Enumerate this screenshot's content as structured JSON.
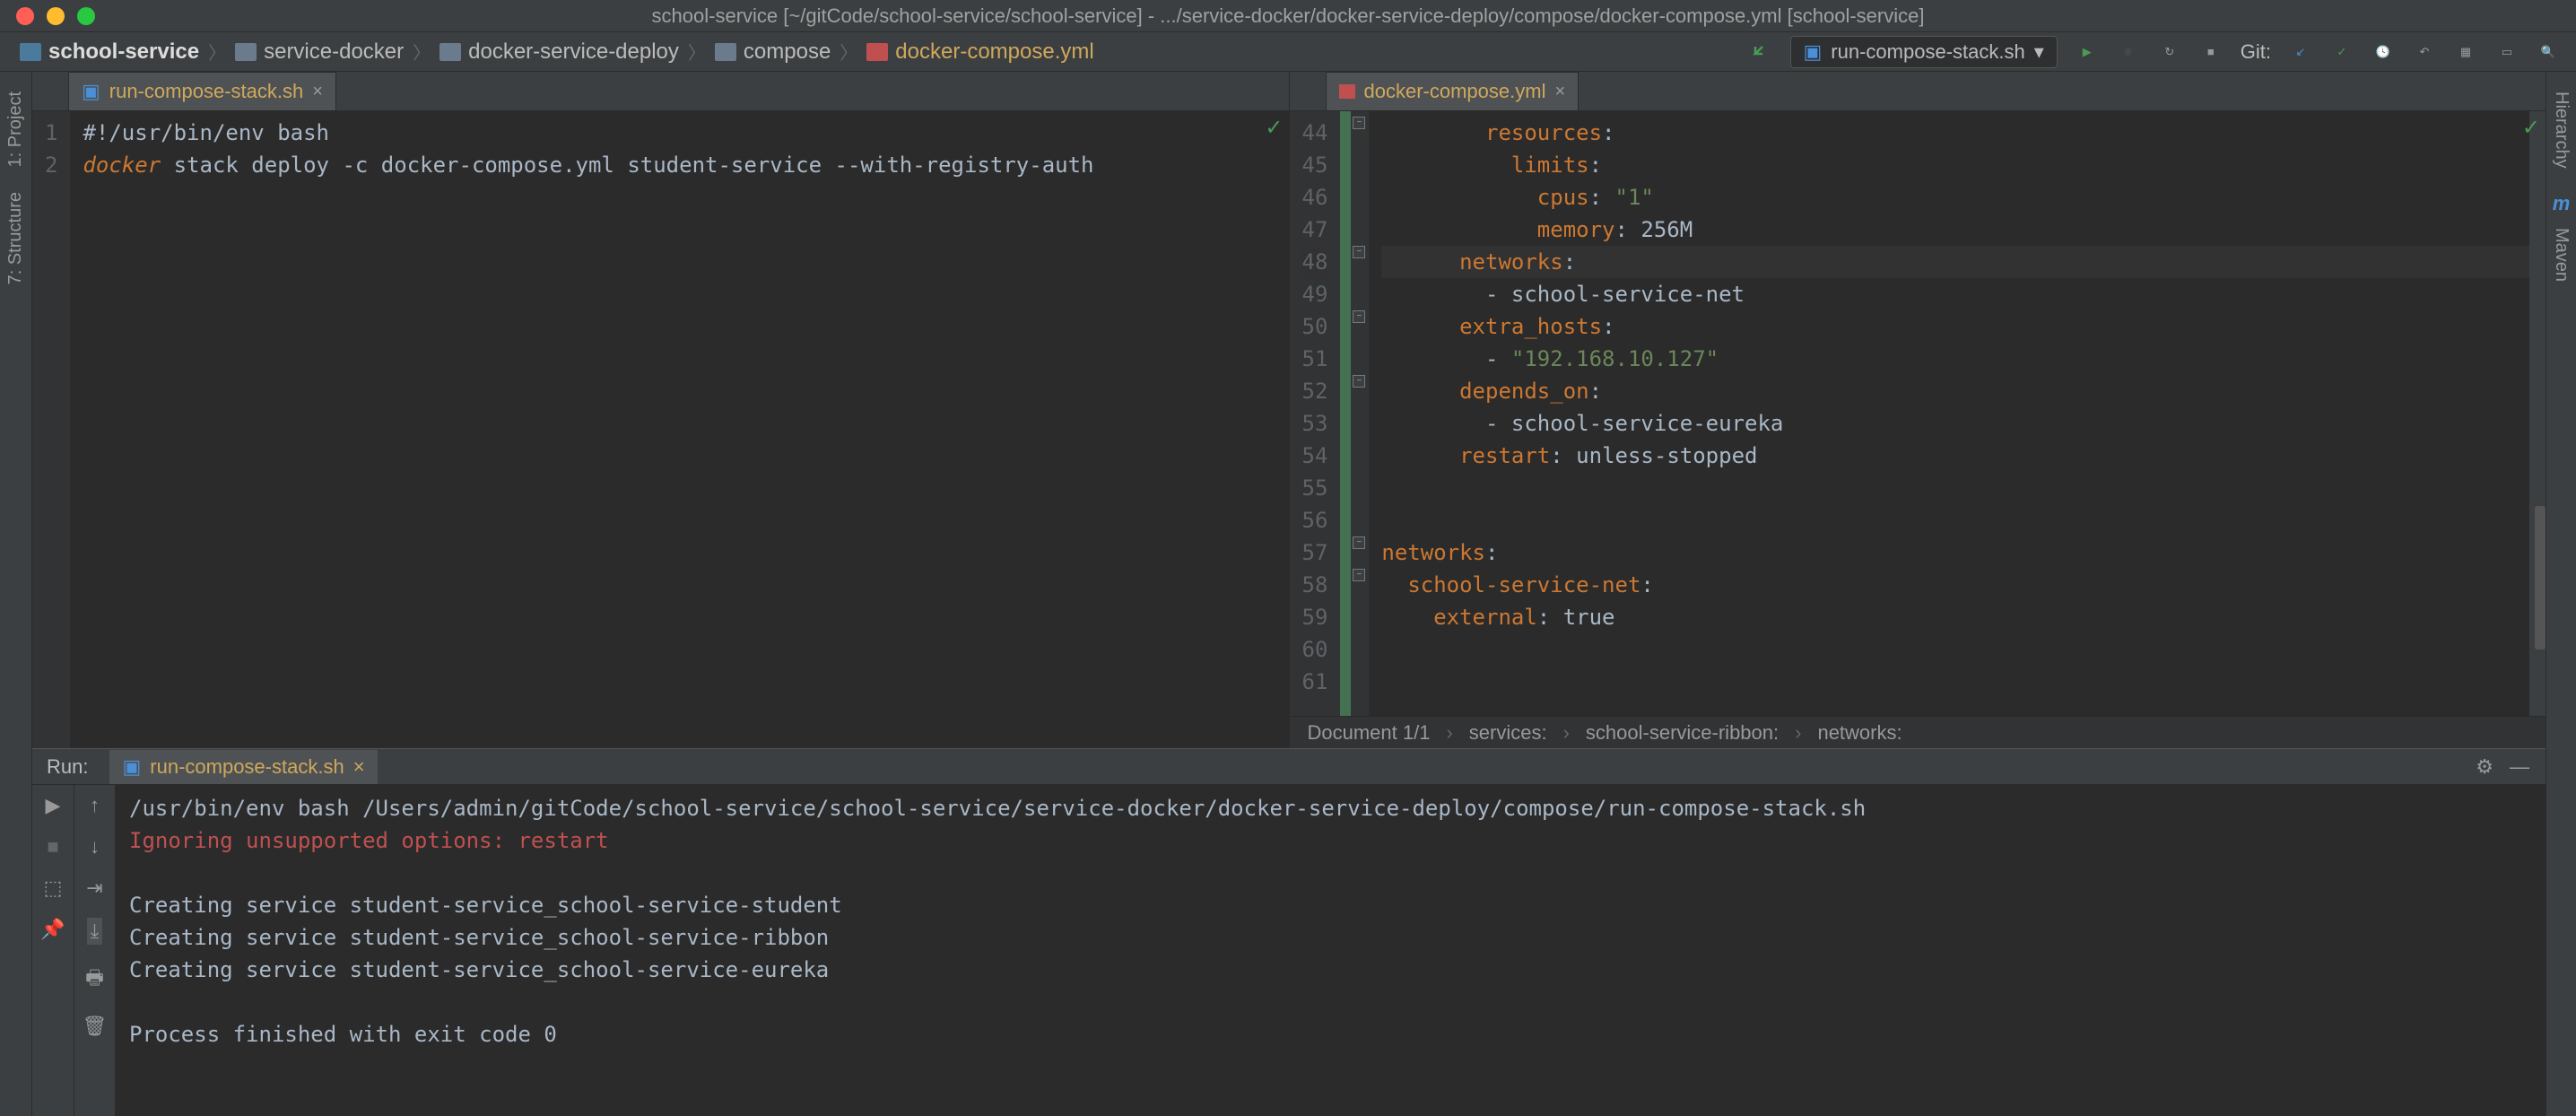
{
  "window": {
    "title": "school-service [~/gitCode/school-service/school-service] - .../service-docker/docker-service-deploy/compose/docker-compose.yml [school-service]"
  },
  "breadcrumbs": {
    "root": "school-service",
    "p1": "service-docker",
    "p2": "docker-service-deploy",
    "p3": "compose",
    "file": "docker-compose.yml"
  },
  "toolbar": {
    "run_config": "run-compose-stack.sh",
    "git_label": "Git:"
  },
  "sidebar_left": {
    "project": "1: Project",
    "structure": "7: Structure"
  },
  "sidebar_right": {
    "hierarchy": "Hierarchy",
    "maven": "Maven"
  },
  "left_editor": {
    "tab": "run-compose-stack.sh",
    "lines": [
      "1",
      "2"
    ],
    "code": {
      "l1_a": "#!/usr/bin/env bash",
      "l2_kw": "docker",
      "l2_rest": " stack deploy -c docker-compose.yml student-service --with-registry-auth"
    }
  },
  "right_editor": {
    "tab": "docker-compose.yml",
    "lines": [
      "44",
      "45",
      "46",
      "47",
      "48",
      "49",
      "50",
      "51",
      "52",
      "53",
      "54",
      "55",
      "56",
      "57",
      "58",
      "59",
      "60",
      "61"
    ],
    "code": {
      "l44_k": "resources",
      "l44_c": ":",
      "l45_k": "limits",
      "l45_c": ":",
      "l46_k": "cpus",
      "l46_c": ": ",
      "l46_v": "\"1\"",
      "l47_k": "memory",
      "l47_c": ": ",
      "l47_v": "256M",
      "l48_k": "networks",
      "l48_c": ":",
      "l49_d": "- ",
      "l49_v": "school-service-net",
      "l50_k": "extra_hosts",
      "l50_c": ":",
      "l51_d": "- ",
      "l51_v": "\"192.168.10.127\"",
      "l52_k": "depends_on",
      "l52_c": ":",
      "l53_d": "- ",
      "l53_v": "school-service-eureka",
      "l54_k": "restart",
      "l54_c": ": ",
      "l54_v": "unless-stopped",
      "l57_k": "networks",
      "l57_c": ":",
      "l58_k": "school-service-net",
      "l58_c": ":",
      "l59_k": "external",
      "l59_c": ": ",
      "l59_v": "true"
    },
    "footer": {
      "doc": "Document 1/1",
      "b1": "services:",
      "b2": "school-service-ribbon:",
      "b3": "networks:"
    }
  },
  "run": {
    "label": "Run:",
    "tab": "run-compose-stack.sh",
    "output": {
      "l1": "/usr/bin/env bash /Users/admin/gitCode/school-service/school-service/service-docker/docker-service-deploy/compose/run-compose-stack.sh",
      "l2": "Ignoring unsupported options: restart",
      "l3": "",
      "l4": "Creating service student-service_school-service-student",
      "l5": "Creating service student-service_school-service-ribbon",
      "l6": "Creating service student-service_school-service-eureka",
      "l7": "",
      "l8": "Process finished with exit code 0"
    }
  }
}
